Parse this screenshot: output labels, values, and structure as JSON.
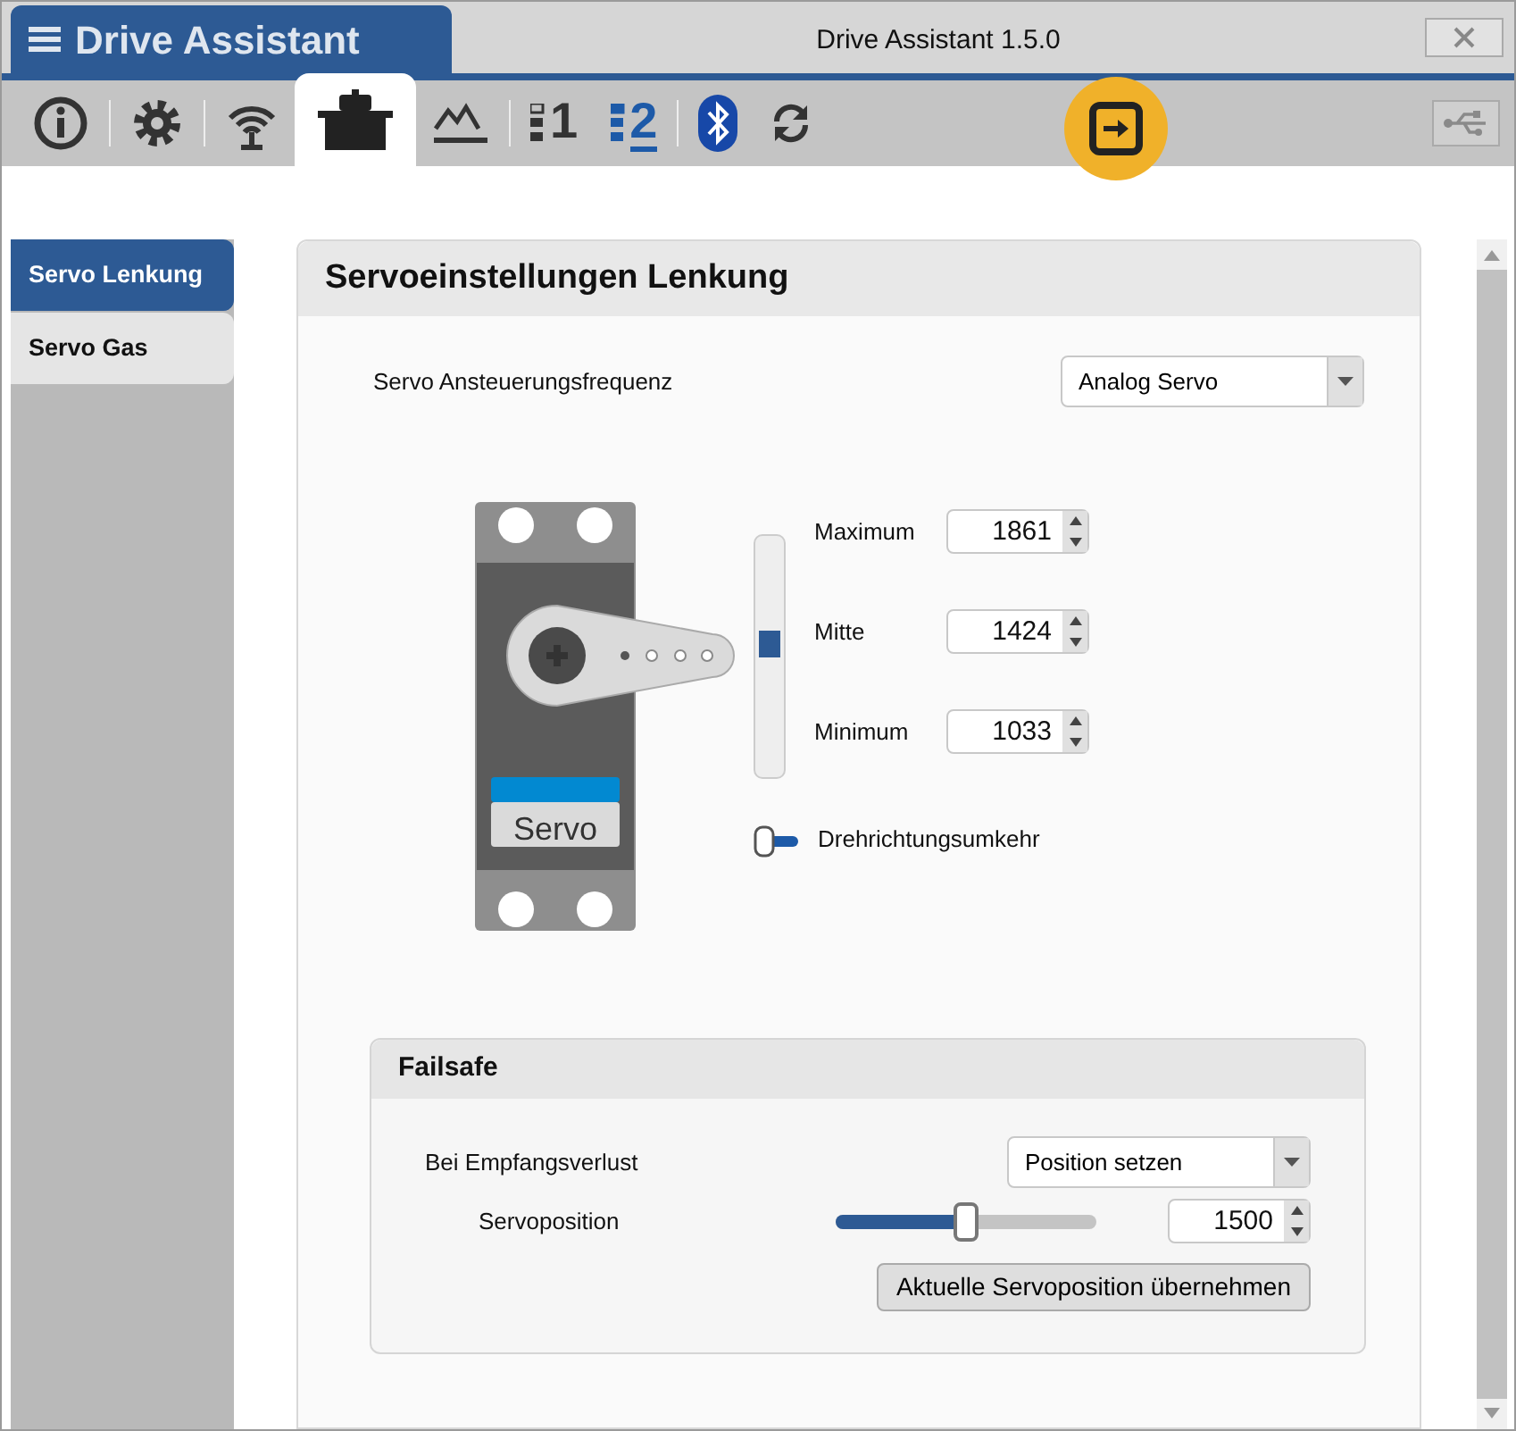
{
  "window": {
    "app_tab": "Drive Assistant",
    "title": "Drive Assistant 1.5.0"
  },
  "toolbar": [
    {
      "kind": "info",
      "selected": false
    },
    {
      "kind": "settings",
      "selected": false
    },
    {
      "kind": "wireless",
      "selected": false
    },
    {
      "kind": "servo",
      "selected": true
    },
    {
      "kind": "chart",
      "selected": false
    },
    {
      "kind": "channel",
      "label": "1",
      "selected": false,
      "highlight": false
    },
    {
      "kind": "channel",
      "label": "2",
      "selected": false,
      "highlight": true
    },
    {
      "kind": "bluetooth",
      "selected": false
    },
    {
      "kind": "refresh",
      "selected": false
    }
  ],
  "connect_button": {
    "kind": "connect"
  },
  "usb_button": {
    "disabled": true
  },
  "sidebar": {
    "items": [
      {
        "label": "Servo Lenkung",
        "selected": true
      },
      {
        "label": "Servo Gas",
        "selected": false
      }
    ]
  },
  "panel": {
    "title": "Servoeinstellungen Lenkung",
    "frequency": {
      "label": "Servo Ansteuerungsfrequenz",
      "value": "Analog Servo"
    },
    "servo_label": "Servo",
    "range": {
      "level": 0.55
    },
    "fields": [
      {
        "label": "Maximum",
        "value": "1861"
      },
      {
        "label": "Mitte",
        "value": "1424"
      },
      {
        "label": "Minimum",
        "value": "1033"
      }
    ],
    "reverse": {
      "label": "Drehrichtungsumkehr",
      "on": false
    },
    "failsafe": {
      "title": "Failsafe",
      "loss_label": "Bei Empfangsverlust",
      "loss_value": "Position setzen",
      "position_label": "Servoposition",
      "position": {
        "level": 0.5
      },
      "position_value": "1500",
      "button": "Aktuelle Servoposition übernehmen"
    }
  }
}
